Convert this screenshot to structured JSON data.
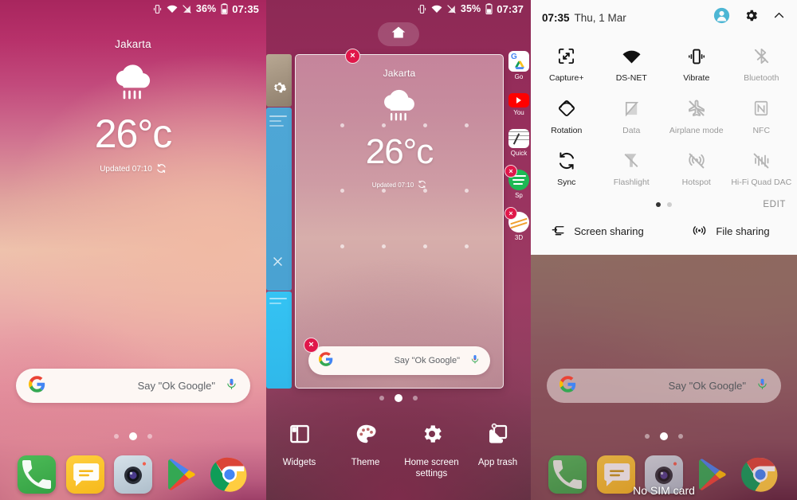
{
  "left_panel": {
    "status_bar": {
      "vibrate_icon": "vibrate-icon",
      "wifi_icon": "wifi-icon",
      "signal_off_icon": "signal-off-icon",
      "battery_percent": "36%",
      "battery_icon": "battery-icon",
      "clock": "07:35"
    },
    "weather": {
      "city": "Jakarta",
      "condition_icon": "rain-cloud-icon",
      "temperature": "26°c",
      "updated": "Updated 07:10",
      "refresh_icon": "refresh-icon"
    },
    "search": {
      "logo": "google-logo-icon",
      "placeholder": "Say \"Ok Google\"",
      "mic_icon": "microphone-icon"
    },
    "page_dots": {
      "count": 3,
      "active_index": 1
    },
    "dock": [
      {
        "name": "phone",
        "label": "Phone"
      },
      {
        "name": "messages",
        "label": "Messages"
      },
      {
        "name": "camera",
        "label": "Camera"
      },
      {
        "name": "play-store",
        "label": "Play Store"
      },
      {
        "name": "chrome",
        "label": "Chrome"
      }
    ]
  },
  "mid_panel": {
    "status_bar": {
      "battery_percent": "35%",
      "clock": "07:37"
    },
    "home_button": "home-icon",
    "preview_card": {
      "weather": {
        "city": "Jakarta",
        "temperature": "26°c",
        "updated": "Updated 07:10"
      },
      "search": {
        "placeholder": "Say \"Ok Google\"",
        "logo": "google-logo-icon",
        "mic_icon": "microphone-icon"
      },
      "remove_badge": "×"
    },
    "page_dots": {
      "count": 3,
      "active_index": 1
    },
    "app_list": [
      {
        "label": "Go",
        "removable": false
      },
      {
        "label": "You",
        "removable": false
      },
      {
        "label": "Quick",
        "removable": false
      },
      {
        "label": "Sp",
        "removable": true
      },
      {
        "label": "3D",
        "removable": true
      }
    ],
    "toolbar": [
      {
        "label": "Widgets",
        "icon": "widgets-icon"
      },
      {
        "label": "Theme",
        "icon": "palette-icon"
      },
      {
        "label": "Home screen settings",
        "icon": "gear-icon"
      },
      {
        "label": "App trash",
        "icon": "app-trash-icon"
      }
    ]
  },
  "right_panel": {
    "quick_settings": {
      "time": "07:35",
      "date": "Thu, 1 Mar",
      "avatar_icon": "user-avatar-icon",
      "avatar_color": "#4db6d4",
      "settings_icon": "gear-icon",
      "collapse_icon": "chevron-up-icon",
      "tiles": [
        {
          "label": "Capture+",
          "icon": "capture-plus-icon",
          "enabled": true
        },
        {
          "label": "DS-NET",
          "icon": "wifi-icon",
          "enabled": true
        },
        {
          "label": "Vibrate",
          "icon": "vibrate-icon",
          "enabled": true
        },
        {
          "label": "Bluetooth",
          "icon": "bluetooth-off-icon",
          "enabled": false
        },
        {
          "label": "Rotation",
          "icon": "rotation-icon",
          "enabled": true
        },
        {
          "label": "Data",
          "icon": "data-off-icon",
          "enabled": false
        },
        {
          "label": "Airplane mode",
          "icon": "airplane-off-icon",
          "enabled": false
        },
        {
          "label": "NFC",
          "icon": "nfc-off-icon",
          "enabled": false
        },
        {
          "label": "Sync",
          "icon": "sync-icon",
          "enabled": true
        },
        {
          "label": "Flashlight",
          "icon": "flashlight-off-icon",
          "enabled": false
        },
        {
          "label": "Hotspot",
          "icon": "hotspot-off-icon",
          "enabled": false
        },
        {
          "label": "Hi-Fi Quad DAC",
          "icon": "hifi-dac-off-icon",
          "enabled": false
        }
      ],
      "page_dots": {
        "count": 2,
        "active_index": 0
      },
      "edit_label": "EDIT",
      "share_items": [
        {
          "label": "Screen sharing",
          "icon": "screen-sharing-icon"
        },
        {
          "label": "File sharing",
          "icon": "file-sharing-icon"
        }
      ]
    },
    "home": {
      "search": {
        "placeholder": "Say \"Ok Google\"",
        "logo": "google-logo-icon",
        "mic_icon": "microphone-icon"
      },
      "page_dots": {
        "count": 3,
        "active_index": 1
      },
      "no_sim_text": "No SIM card"
    }
  }
}
